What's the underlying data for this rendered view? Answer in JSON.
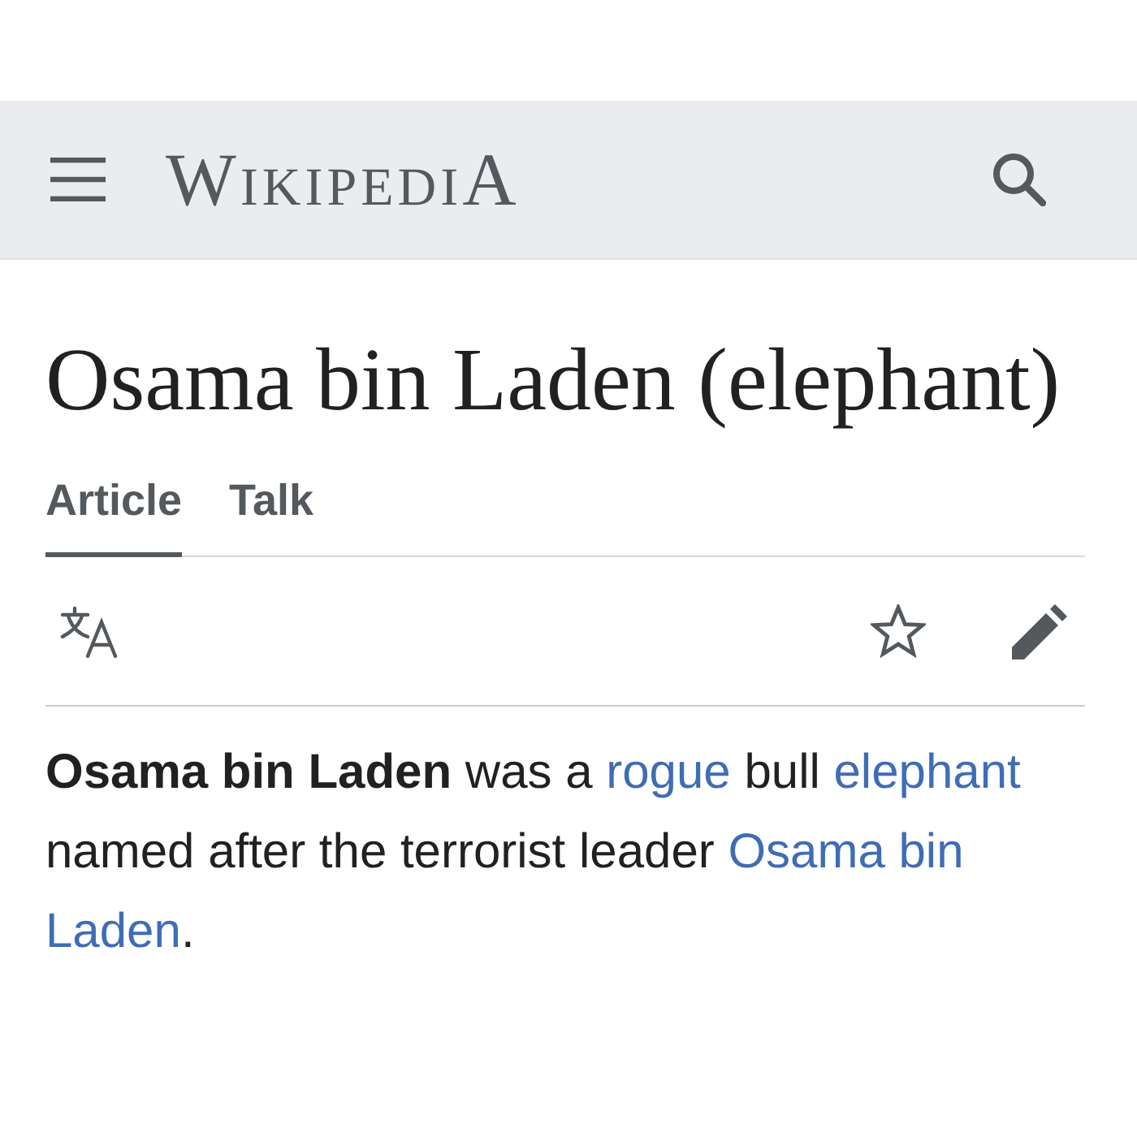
{
  "header": {
    "logo": "WIKIPEDIA"
  },
  "page_title": "Osama bin Laden (elephant)",
  "tabs": [
    {
      "label": "Article",
      "selected": true
    },
    {
      "label": "Talk",
      "selected": false
    }
  ],
  "intro": {
    "lines": [
      [
        {
          "kind": "bold",
          "text": "Osama bin Laden"
        },
        {
          "kind": "plain",
          "text": " was a "
        },
        {
          "kind": "link",
          "text": "rogue"
        },
        {
          "kind": "plain",
          "text": " bull "
        },
        {
          "kind": "link",
          "text": "elephant"
        }
      ],
      [
        {
          "kind": "plain",
          "text": "named after the terrorist leader "
        },
        {
          "kind": "link",
          "text": "Osama bin"
        }
      ],
      [
        {
          "kind": "link",
          "text": "Laden"
        },
        {
          "kind": "plain",
          "text": "."
        }
      ]
    ]
  }
}
